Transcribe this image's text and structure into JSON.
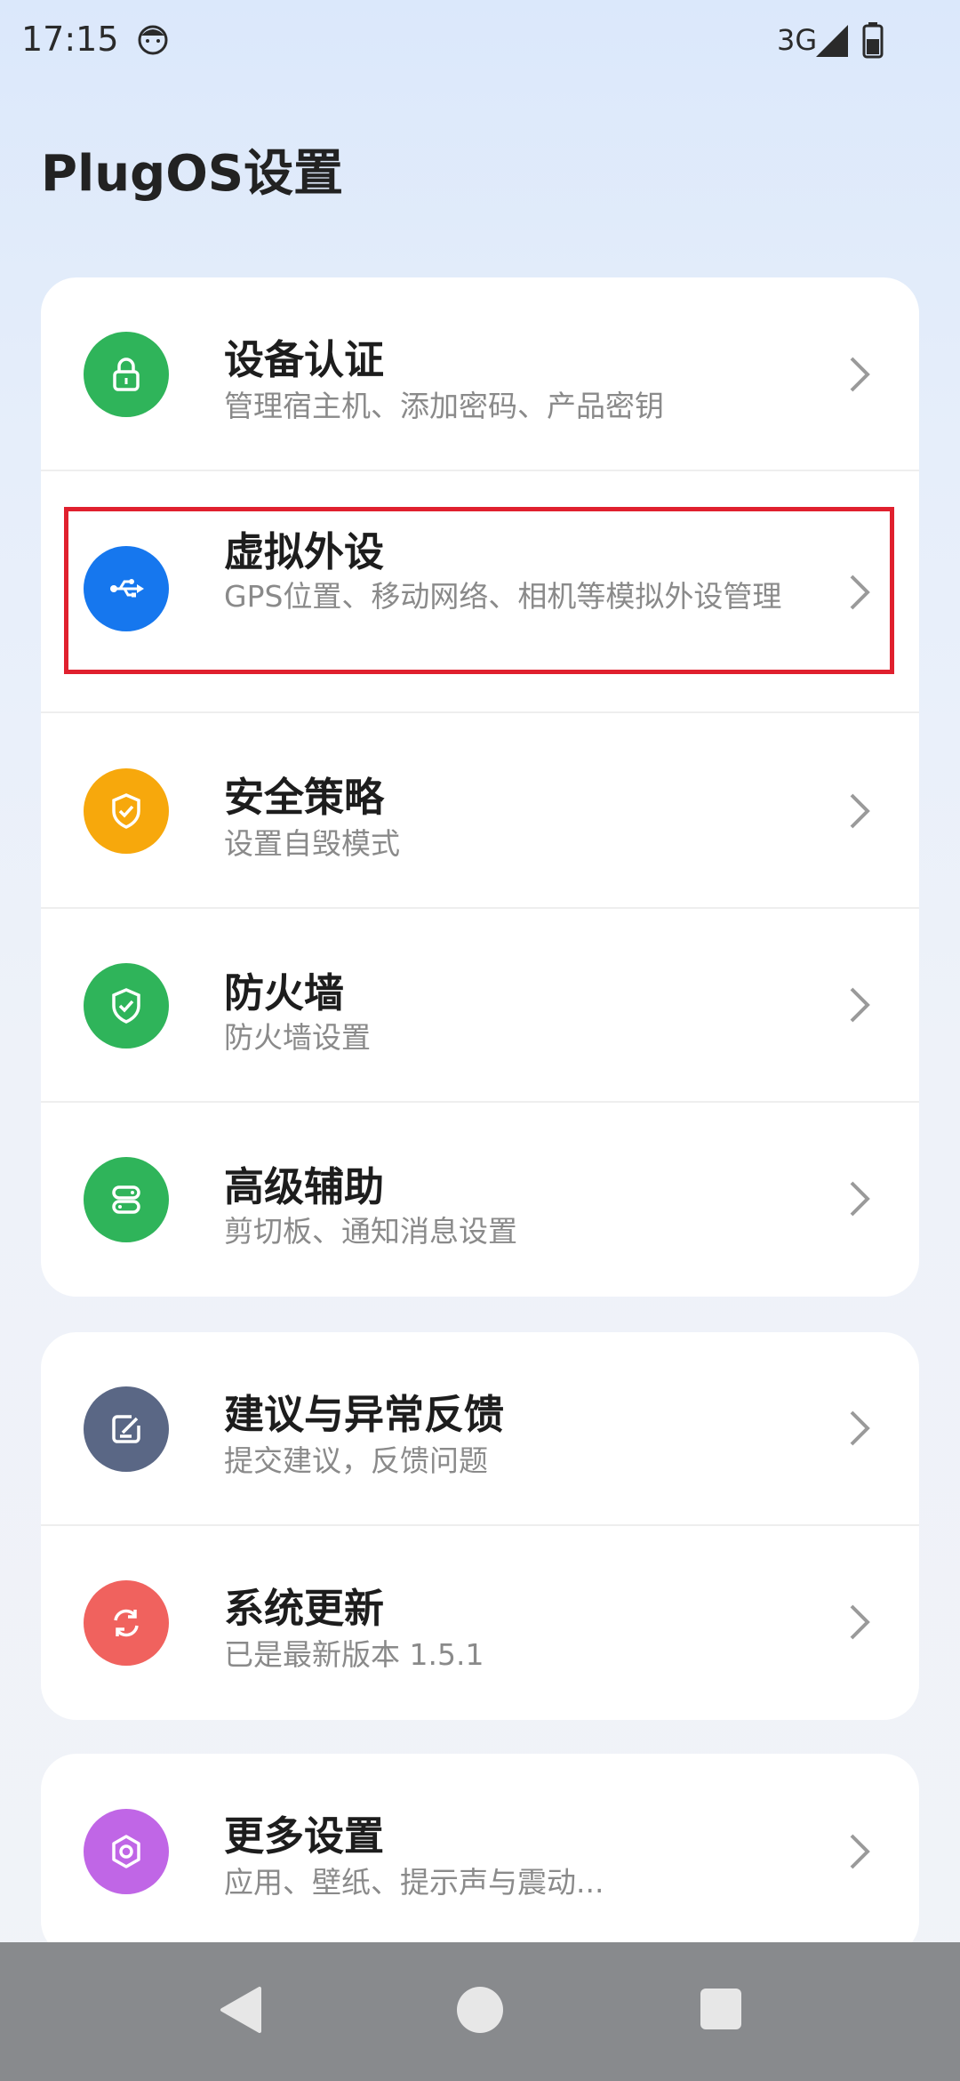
{
  "status": {
    "time": "17:15",
    "network": "3G"
  },
  "page": {
    "title": "PlugOS设置"
  },
  "groups": [
    {
      "items": [
        {
          "title": "设备认证",
          "subtitle": "管理宿主机、添加密码、产品密钥",
          "icon": "lock-icon",
          "color": "#2fb45a"
        },
        {
          "title": "虚拟外设",
          "subtitle": "GPS位置、移动网络、相机等模拟外设管理",
          "icon": "usb-icon",
          "color": "#1677ee"
        },
        {
          "title": "安全策略",
          "subtitle": "设置自毁模式",
          "icon": "shield-icon",
          "color": "#f7a80c"
        },
        {
          "title": "防火墙",
          "subtitle": "防火墙设置",
          "icon": "shield-check-icon",
          "color": "#2fb45a"
        },
        {
          "title": "高级辅助",
          "subtitle": "剪切板、通知消息设置",
          "icon": "toggle-icon",
          "color": "#2fb45a"
        }
      ]
    },
    {
      "items": [
        {
          "title": "建议与异常反馈",
          "subtitle": "提交建议，反馈问题",
          "icon": "edit-icon",
          "color": "#5a6785"
        },
        {
          "title": "系统更新",
          "subtitle": "已是最新版本 1.5.1",
          "icon": "refresh-icon",
          "color": "#f0625e"
        }
      ]
    },
    {
      "items": [
        {
          "title": "更多设置",
          "subtitle": "应用、壁纸、提示声与震动...",
          "icon": "gear-icon",
          "color": "#c066e6"
        }
      ]
    }
  ]
}
